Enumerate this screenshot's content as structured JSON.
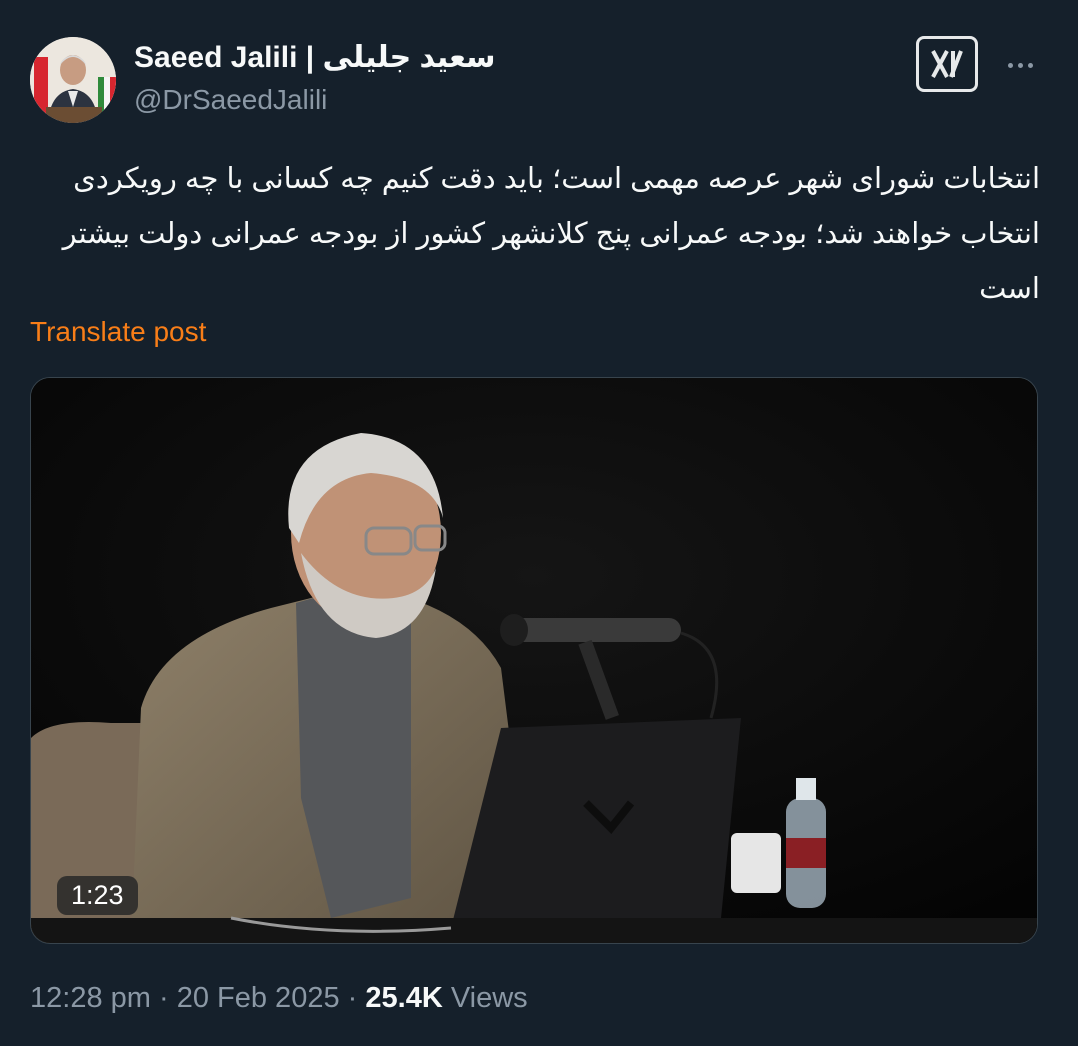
{
  "author": {
    "name": "Saeed Jalili | سعید جلیلی",
    "handle": "@DrSaeedJalili"
  },
  "post": {
    "text": "انتخابات شورای شهر عرصه مهمی است؛ باید دقت کنیم چه کسانی با چه رویکردی انتخاب خواهند شد؛ بودجه عمرانی پنج کلانشهر کشور از بودجه عمرانی دولت بیشتر است",
    "translate_label": "Translate post"
  },
  "media": {
    "duration": "1:23"
  },
  "meta": {
    "time": "12:28 pm",
    "date": "20 Feb 2025",
    "separator": "·",
    "views_count": "25.4K",
    "views_label": "Views"
  },
  "icons": {
    "logo": "x-logo-icon",
    "more": "more-icon",
    "avatar": "avatar"
  },
  "colors": {
    "background": "#15202b",
    "text": "#f7f9f9",
    "secondary": "#8b98a5",
    "translate": "#f97e18"
  }
}
